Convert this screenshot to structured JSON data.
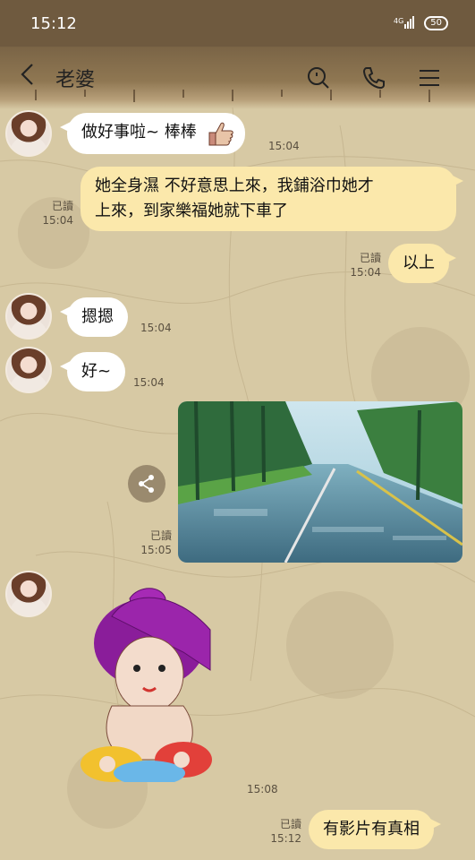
{
  "status_bar": {
    "time": "15:12",
    "signal": "4G",
    "battery": "50"
  },
  "header": {
    "title": "老婆",
    "back_icon": "chevron-left-icon",
    "search_icon": "search-icon",
    "call_icon": "phone-icon",
    "menu_icon": "menu-icon"
  },
  "messages": [
    {
      "side": "in",
      "text": "做好事啦~ 棒棒",
      "time": "15:04",
      "emoji": "thumbs-up"
    },
    {
      "side": "out",
      "text_line1": "她全身濕 不好意思上來，我鋪浴巾她才",
      "text_line2": "上來，到家樂福她就下車了",
      "read": "已讀",
      "time": "15:04"
    },
    {
      "side": "out",
      "text": "以上",
      "read": "已讀",
      "time": "15:04"
    },
    {
      "side": "in",
      "text": "摁摁",
      "time": "15:04"
    },
    {
      "side": "in",
      "text": "好~",
      "time": "15:04"
    },
    {
      "side": "out",
      "type": "image",
      "read": "已讀",
      "time": "15:05"
    },
    {
      "side": "in",
      "type": "sticker",
      "time": "15:08"
    },
    {
      "side": "out",
      "text": "有影片有真相",
      "read": "已讀",
      "time": "15:12"
    }
  ]
}
